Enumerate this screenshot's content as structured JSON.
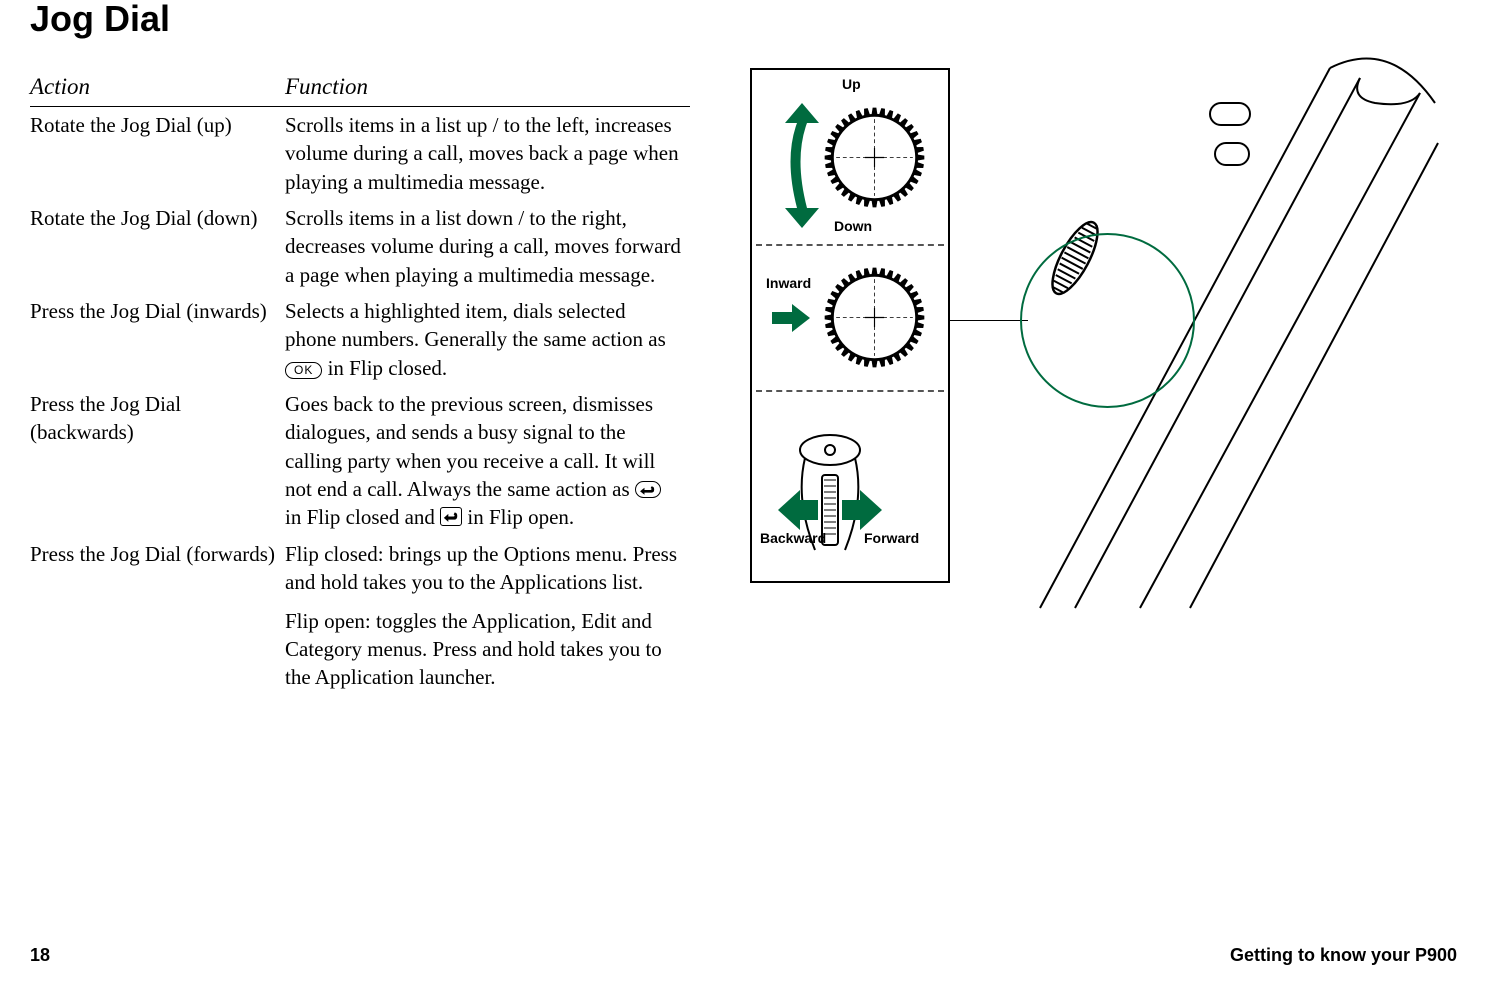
{
  "title": "Jog Dial",
  "table": {
    "head_action": "Action",
    "head_function": "Function",
    "rows": [
      {
        "action": "Rotate the Jog Dial (up)",
        "fn": "Scrolls items in a list up / to the left, increases volume during a call, moves back a page when playing a multimedia message."
      },
      {
        "action": "Rotate the Jog Dial (down)",
        "fn": "Scrolls items in a list down / to the right, decreases volume during a call, moves forward a page when playing a multimedia message."
      },
      {
        "action": "Press the Jog Dial (inwards)",
        "fn_pre": "Selects a highlighted item, dials selected phone numbers. Generally the same action as ",
        "fn_ok": "OK",
        "fn_post": " in Flip closed."
      },
      {
        "action": "Press the Jog Dial (backwards)",
        "fn_pre": "Goes back to the previous screen, dismisses dialogues, and sends a busy signal to the calling party when you receive a call. It will not end a call. Always the same action as ",
        "fn_mid": " in Flip closed and ",
        "fn_post": " in Flip open."
      },
      {
        "action": "Press the Jog Dial (forwards)",
        "fn_a": "Flip closed: brings up the Options menu. Press and hold takes you to the Applications list.",
        "fn_b": "Flip open: toggles the Application, Edit and Category menus. Press and hold takes you to the Application launcher."
      }
    ]
  },
  "diagram": {
    "up": "Up",
    "down": "Down",
    "inward": "Inward",
    "backward": "Backward",
    "forward": "Forward"
  },
  "footer": {
    "page": "18",
    "section": "Getting to know your P900"
  }
}
